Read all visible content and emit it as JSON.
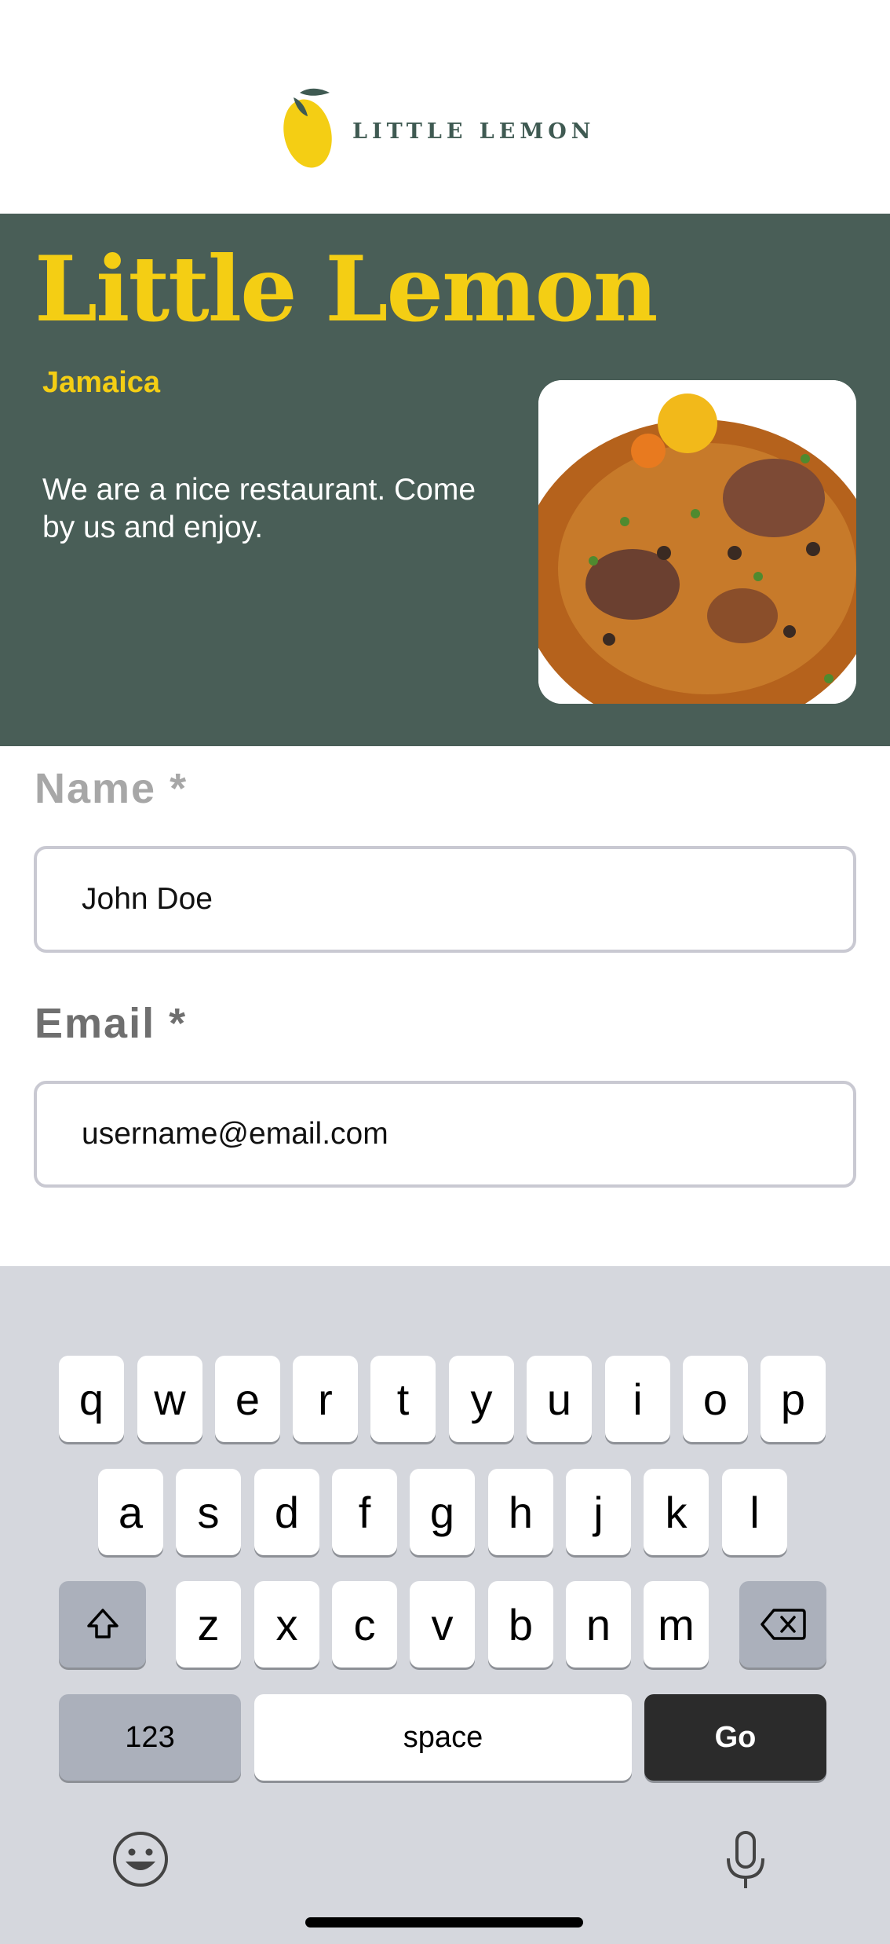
{
  "brand": {
    "logo_text": "LITTLE LEMON"
  },
  "hero": {
    "title": "Little Lemon",
    "city": "Jamaica",
    "description": "We are a nice restaurant. Come by us and enjoy."
  },
  "form": {
    "name_label": "Name *",
    "name_value": "John Doe",
    "email_label": "Email *",
    "email_value": "username@email.com"
  },
  "keyboard": {
    "row1": [
      "q",
      "w",
      "e",
      "r",
      "t",
      "y",
      "u",
      "i",
      "o",
      "p"
    ],
    "row2": [
      "a",
      "s",
      "d",
      "f",
      "g",
      "h",
      "j",
      "k",
      "l"
    ],
    "row3": [
      "z",
      "x",
      "c",
      "v",
      "b",
      "n",
      "m"
    ],
    "numbers_label": "123",
    "space_label": "space",
    "go_label": "Go",
    "icons": [
      "shift-icon",
      "backspace-icon",
      "emoji-icon",
      "microphone-icon"
    ]
  },
  "colors": {
    "primary_green": "#495e57",
    "primary_yellow": "#f4ce14",
    "keyboard_bg": "#d5d7dd",
    "go_key": "#2b2b2b"
  }
}
